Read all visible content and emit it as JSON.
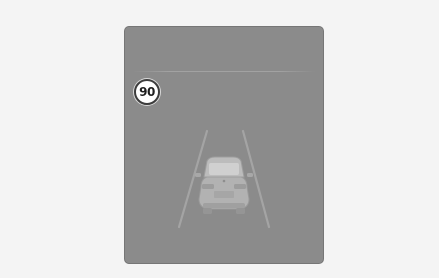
{
  "display": {
    "speed_limit": "90"
  }
}
